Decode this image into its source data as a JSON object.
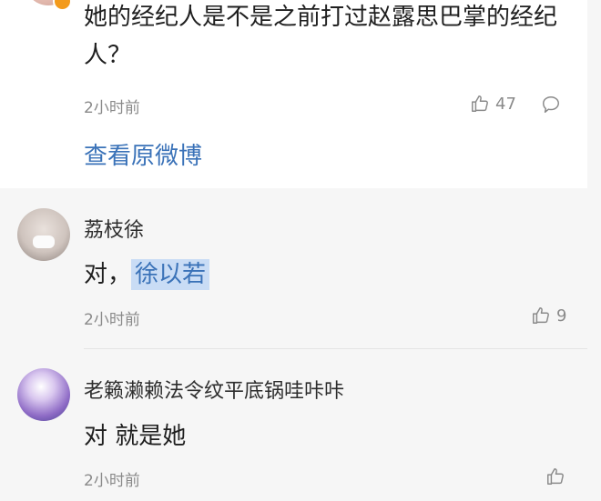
{
  "top_post": {
    "text": "她的经纪人是不是之前打过赵露思巴掌的经纪人？",
    "time": "2小时前",
    "likes": "47",
    "view_original": "查看原微博"
  },
  "comments": [
    {
      "username": "荔枝徐",
      "text_prefix": "对，",
      "text_highlight": "徐以若",
      "time": "2小时前",
      "likes": "9"
    },
    {
      "username": "老籁濑赖法令纹平底锅哇咔咔",
      "text": "对 就是她",
      "time": "2小时前",
      "likes": ""
    }
  ],
  "colors": {
    "link": "#3a72b8",
    "highlight": "#c9dcf5",
    "meta": "#8a8a8a"
  }
}
